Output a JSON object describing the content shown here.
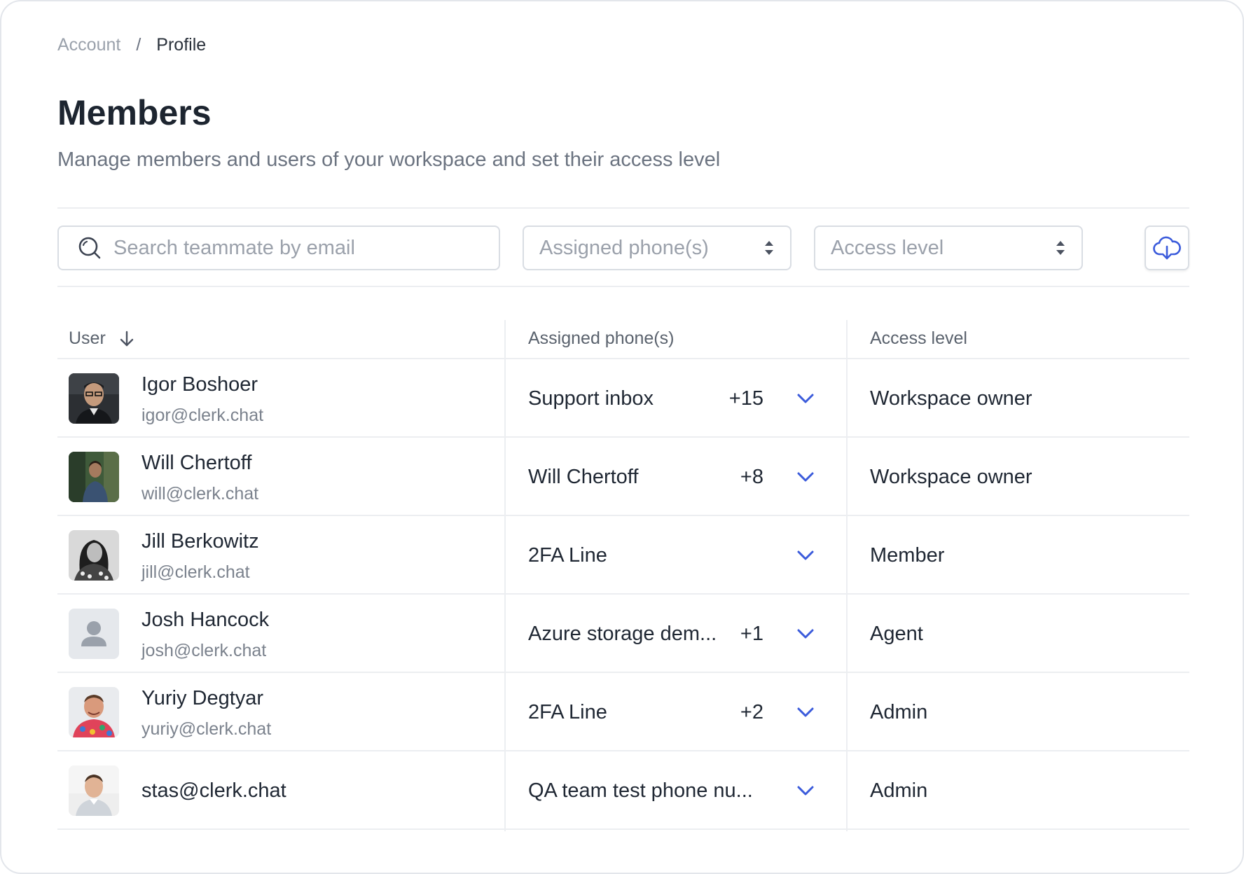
{
  "breadcrumb": {
    "parent": "Account",
    "separator": "/",
    "current": "Profile"
  },
  "page": {
    "title": "Members",
    "subtitle": "Manage members and users of your workspace and set their access level"
  },
  "filters": {
    "search_placeholder": "Search teammate by email",
    "phone_select_placeholder": "Assigned phone(s)",
    "access_select_placeholder": "Access level",
    "download_icon": "cloud-download-icon"
  },
  "table": {
    "columns": {
      "user": "User",
      "phones": "Assigned phone(s)",
      "access": "Access level"
    },
    "rows": [
      {
        "name": "Igor Boshoer",
        "email": "igor@clerk.chat",
        "phone": "Support inbox",
        "extra": "+15",
        "access": "Workspace owner"
      },
      {
        "name": "Will Chertoff",
        "email": "will@clerk.chat",
        "phone": "Will Chertoff",
        "extra": "+8",
        "access": "Workspace owner"
      },
      {
        "name": "Jill Berkowitz",
        "email": "jill@clerk.chat",
        "phone": "2FA Line",
        "extra": "",
        "access": "Member"
      },
      {
        "name": "Josh Hancock",
        "email": "josh@clerk.chat",
        "phone": "Azure storage dem...",
        "extra": "+1",
        "access": "Agent"
      },
      {
        "name": "Yuriy Degtyar",
        "email": "yuriy@clerk.chat",
        "phone": "2FA Line",
        "extra": "+2",
        "access": "Admin"
      },
      {
        "name": "",
        "email": "stas@clerk.chat",
        "phone": "QA team test phone nu...",
        "extra": "",
        "access": "Admin"
      }
    ]
  },
  "colors": {
    "accent": "#3b5bdb",
    "border": "#d9dde3",
    "muted_text": "#7b828d"
  }
}
